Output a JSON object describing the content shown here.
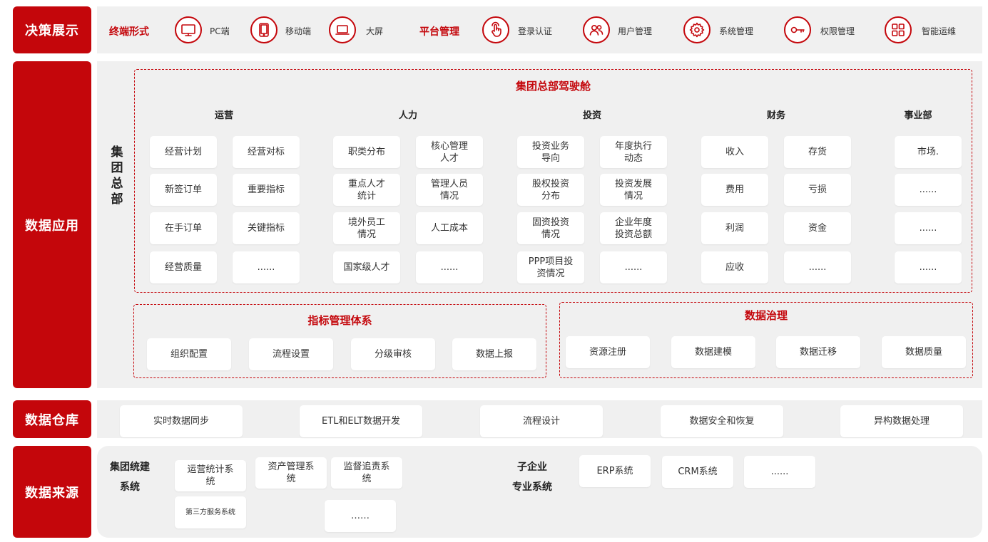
{
  "rows": {
    "decision": "决策展示",
    "application": "数据应用",
    "warehouse": "数据仓库",
    "source": "数据来源"
  },
  "decision": {
    "terminal_label": "终端形式",
    "platform_label": "平台管理",
    "items": [
      {
        "label": "PC端",
        "icon": "monitor-icon"
      },
      {
        "label": "移动端",
        "icon": "tablet-icon"
      },
      {
        "label": "大屏",
        "icon": "laptop-icon"
      },
      {
        "label": "登录认证",
        "icon": "touch-hand-icon"
      },
      {
        "label": "用户管理",
        "icon": "users-icon"
      },
      {
        "label": "系统管理",
        "icon": "gear-icon"
      },
      {
        "label": "权限管理",
        "icon": "key-icon"
      },
      {
        "label": "智能运维",
        "icon": "grid-icon"
      }
    ]
  },
  "application": {
    "hq_vertical": [
      "集",
      "团",
      "总",
      "部"
    ],
    "cockpit": {
      "title": "集团总部驾驶舱",
      "columns": [
        {
          "header": "运营",
          "cells": [
            "经营计划",
            "经营对标",
            "新签订单",
            "重要指标",
            "在手订单",
            "关键指标",
            "经营质量",
            "......"
          ]
        },
        {
          "header": "人力",
          "cells": [
            "职类分布",
            "核心管理\n人才",
            "重点人才\n统计",
            "管理人员\n情况",
            "境外员工\n情况",
            "人工成本",
            "国家级人才",
            "......"
          ]
        },
        {
          "header": "投资",
          "cells": [
            "投资业务\n导向",
            "年度执行\n动态",
            "股权投资\n分布",
            "投资发展\n情况",
            "固资投资\n情况",
            "企业年度\n投资总额",
            "PPP项目投\n资情况",
            "......"
          ]
        },
        {
          "header": "财务",
          "cells": [
            "收入",
            "存货",
            "费用",
            "亏损",
            "利润",
            "资金",
            "应收",
            "......"
          ]
        },
        {
          "header": "事业部",
          "cells": [
            "市场.",
            "......",
            "......",
            "......"
          ]
        }
      ]
    },
    "indicator": {
      "title": "指标管理体系",
      "items": [
        "组织配置",
        "流程设置",
        "分级审核",
        "数据上报"
      ]
    },
    "governance": {
      "title": "数据治理",
      "items": [
        "资源注册",
        "数据建模",
        "数据迁移",
        "数据质量"
      ]
    }
  },
  "warehouse": {
    "items": [
      "实时数据同步",
      "ETL和ELT数据开发",
      "流程设计",
      "数据安全和恢复",
      "异构数据处理"
    ]
  },
  "source": {
    "group_label_1": "集团统建",
    "group_label_2": "系统",
    "group_items": [
      "运营统计系\n统",
      "资产管理系\n统",
      "监督追责系\n统",
      "第三方服务系统",
      "……"
    ],
    "sub_label_1": "子企业",
    "sub_label_2": "专业系统",
    "sub_items": [
      "ERP系统",
      "CRM系统",
      "......"
    ]
  },
  "colors": {
    "accent": "#c4060b",
    "panel": "#f0f0f0"
  }
}
